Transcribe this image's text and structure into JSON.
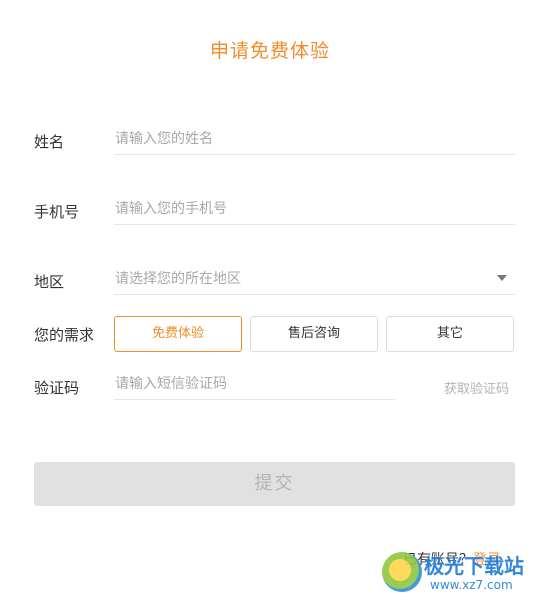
{
  "title": "申请免费体验",
  "fields": {
    "name": {
      "label": "姓名",
      "placeholder": "请输入您的姓名"
    },
    "phone": {
      "label": "手机号",
      "placeholder": "请输入您的手机号"
    },
    "region": {
      "label": "地区",
      "placeholder": "请选择您的所在地区"
    }
  },
  "needs": {
    "label": "您的需求",
    "options": [
      "免费体验",
      "售后咨询",
      "其它"
    ],
    "selected": "免费体验"
  },
  "code": {
    "label": "验证码",
    "placeholder": "请输入短信验证码",
    "get_label": "获取验证码"
  },
  "submit_label": "提交",
  "footer": {
    "have_account": "已有账号？",
    "login_label": "登录"
  },
  "watermark": {
    "brand": "极光下载站",
    "url": "www.xz7.com"
  },
  "colors": {
    "accent": "#f08c2c",
    "disabled_bg": "#e1e1e1",
    "placeholder": "#a8a8a8",
    "watermark": "#1e7bd4"
  },
  "icons": {
    "dropdown": "caret-down-icon",
    "watermark_logo": "aurora-logo-icon"
  }
}
